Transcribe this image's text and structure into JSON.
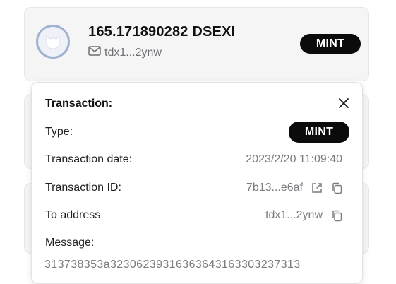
{
  "list": {
    "top_card": {
      "amount": "165.171890282 DSEXI",
      "address": "tdx1...2ynw",
      "type_badge": "MINT"
    }
  },
  "popover": {
    "title": "Transaction:",
    "rows": {
      "type": {
        "label": "Type:",
        "value": "MINT"
      },
      "date": {
        "label": "Transaction date:",
        "value": "2023/2/20 11:09:40"
      },
      "txid": {
        "label": "Transaction ID:",
        "value": "7b13...e6af"
      },
      "to": {
        "label": "To address",
        "value": "tdx1...2ynw"
      },
      "message": {
        "label": "Message:",
        "value": "313738353a32306239316363643163303237313"
      }
    }
  },
  "icons": {
    "avatar": "token-avatar-icon",
    "mail": "mail-icon",
    "close": "close-icon",
    "external": "external-link-icon",
    "copy": "copy-icon"
  },
  "colors": {
    "badge_bg": "#0b0b0b",
    "avatar_ring": "#9fb3d1",
    "card_bg": "#f5f5f6",
    "muted_text": "#7b7b80"
  }
}
